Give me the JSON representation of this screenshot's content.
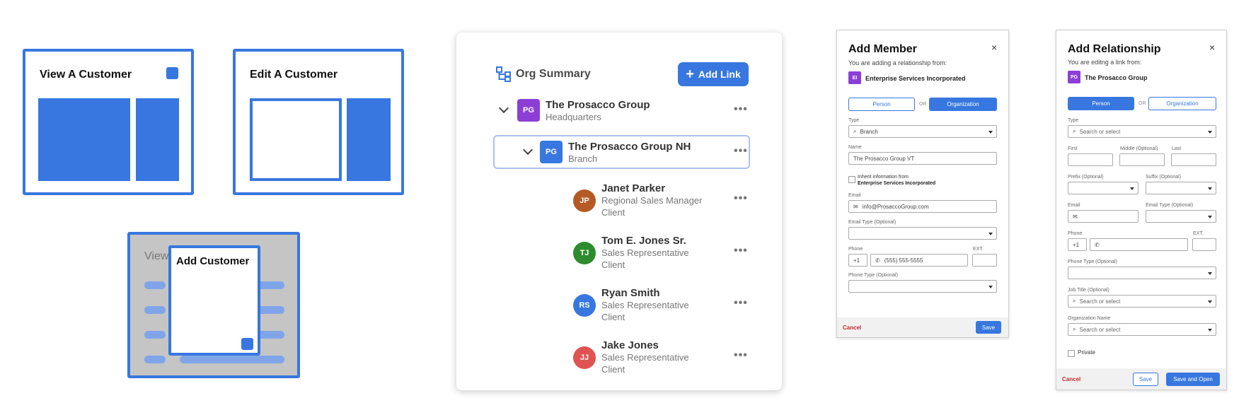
{
  "wireframes": {
    "view_title": "View A Customer",
    "edit_title": "Edit A Customer",
    "add_title": "Add Customer",
    "bg_title": "View"
  },
  "org": {
    "title": "Org Summary",
    "add_link": "Add Link",
    "items": [
      {
        "name": "The Prosacco Group",
        "sub1": "Headquarters",
        "sub2": "",
        "initials": "PG",
        "color": "#8c3fd6"
      },
      {
        "name": "The Prosacco Group NH",
        "sub1": "Branch",
        "sub2": "",
        "initials": "PG",
        "color": "#3777df"
      },
      {
        "name": "Janet Parker",
        "sub1": "Regional Sales Manager",
        "sub2": "Client",
        "initials": "JP",
        "color": "#b45a24"
      },
      {
        "name": "Tom E. Jones Sr.",
        "sub1": "Sales Representative",
        "sub2": "Client",
        "initials": "TJ",
        "color": "#2e8b2e"
      },
      {
        "name": "Ryan Smith",
        "sub1": "Sales Representative",
        "sub2": "Client",
        "initials": "RS",
        "color": "#3777df"
      },
      {
        "name": "Jake Jones",
        "sub1": "Sales Representative",
        "sub2": "Client",
        "initials": "JJ",
        "color": "#e05353"
      }
    ],
    "more": "•••"
  },
  "member": {
    "title": "Add Member",
    "close": "×",
    "intro": "You are adding a relationship from:",
    "from_initials": "EI",
    "from_name": "Enterprise Services Incorporated",
    "person": "Person",
    "or": "OR",
    "organization": "Organization",
    "type_label": "Type",
    "type_value": "Branch",
    "name_label": "Name",
    "name_value": "The Prosacco Group VT",
    "inherit_line1": "Inherit information from",
    "inherit_line2": "Enterprise Services Incorporated",
    "email_label": "Email",
    "email_value": "info@ProsaccoGroup.com",
    "email_type_label": "Email Type (Optional)",
    "phone_label": "Phone",
    "ext_label": "EXT.",
    "country_code": "+1",
    "phone_value": "(555) 555-5555",
    "phone_type_label": "Phone Type (Optional)",
    "cancel": "Cancel",
    "save": "Save"
  },
  "relationship": {
    "title": "Add Relationship",
    "close": "×",
    "intro": "You are editng a link from:",
    "from_initials": "PG",
    "from_name": "The Prosacco Group",
    "person": "Person",
    "or": "OR",
    "organization": "Organization",
    "type_label": "Type",
    "search_placeholder": "Search or select",
    "first_label": "First",
    "middle_label": "Middle (Optional)",
    "last_label": "Last",
    "prefix_label": "Prefix (Optional)",
    "suffix_label": "Suffix (Optional)",
    "email_label": "Email",
    "email_type_label": "Email Type (Optional)",
    "phone_label": "Phone",
    "ext_label": "EXT.",
    "country_code": "+1",
    "phone_type_label": "Phone Type (Optional)",
    "job_title_label": "Job Title (Optional)",
    "org_name_label": "Organization Name",
    "private_label": "Private",
    "cancel": "Cancel",
    "save": "Save",
    "save_open": "Save and Open"
  }
}
